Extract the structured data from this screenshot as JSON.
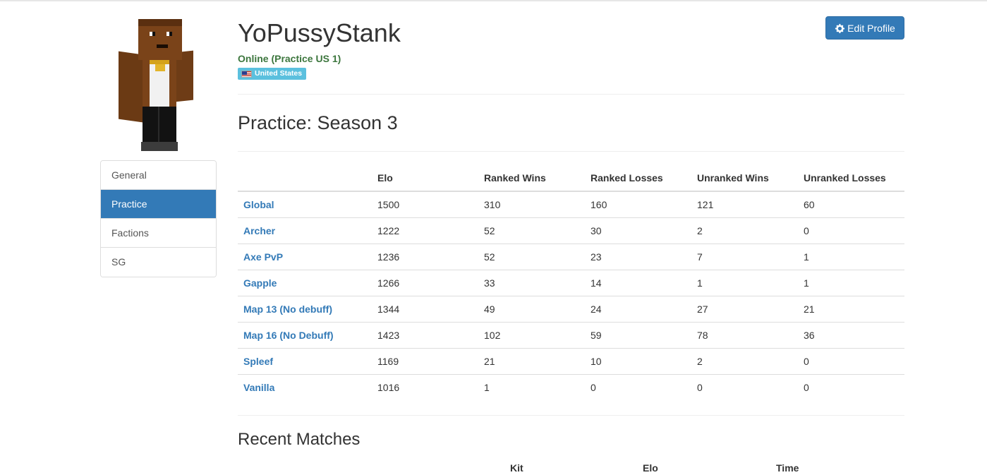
{
  "profile": {
    "username": "YoPussyStank",
    "status": "Online (Practice US 1)",
    "country": "United States",
    "edit_label": "Edit Profile"
  },
  "sidebar": {
    "items": [
      {
        "label": "General"
      },
      {
        "label": "Practice"
      },
      {
        "label": "Factions"
      },
      {
        "label": "SG"
      }
    ]
  },
  "practice": {
    "title": "Practice: Season 3",
    "columns": [
      "",
      "Elo",
      "Ranked Wins",
      "Ranked Losses",
      "Unranked Wins",
      "Unranked Losses"
    ],
    "rows": [
      {
        "kit": "Global",
        "elo": "1500",
        "ranked_wins": "310",
        "ranked_losses": "160",
        "unranked_wins": "121",
        "unranked_losses": "60"
      },
      {
        "kit": "Archer",
        "elo": "1222",
        "ranked_wins": "52",
        "ranked_losses": "30",
        "unranked_wins": "2",
        "unranked_losses": "0"
      },
      {
        "kit": "Axe PvP",
        "elo": "1236",
        "ranked_wins": "52",
        "ranked_losses": "23",
        "unranked_wins": "7",
        "unranked_losses": "1"
      },
      {
        "kit": "Gapple",
        "elo": "1266",
        "ranked_wins": "33",
        "ranked_losses": "14",
        "unranked_wins": "1",
        "unranked_losses": "1"
      },
      {
        "kit": "Map 13 (No debuff)",
        "elo": "1344",
        "ranked_wins": "49",
        "ranked_losses": "24",
        "unranked_wins": "27",
        "unranked_losses": "21"
      },
      {
        "kit": "Map 16 (No Debuff)",
        "elo": "1423",
        "ranked_wins": "102",
        "ranked_losses": "59",
        "unranked_wins": "78",
        "unranked_losses": "36"
      },
      {
        "kit": "Spleef",
        "elo": "1169",
        "ranked_wins": "21",
        "ranked_losses": "10",
        "unranked_wins": "2",
        "unranked_losses": "0"
      },
      {
        "kit": "Vanilla",
        "elo": "1016",
        "ranked_wins": "1",
        "ranked_losses": "0",
        "unranked_wins": "0",
        "unranked_losses": "0"
      }
    ]
  },
  "recent_matches": {
    "title": "Recent Matches",
    "columns": [
      "Kit",
      "Elo",
      "Time"
    ]
  },
  "colors": {
    "primary": "#337ab7",
    "online": "#3c763d",
    "badge": "#5bc0de"
  },
  "icons": {
    "edit": "gear-icon",
    "flag": "us-flag-icon"
  }
}
